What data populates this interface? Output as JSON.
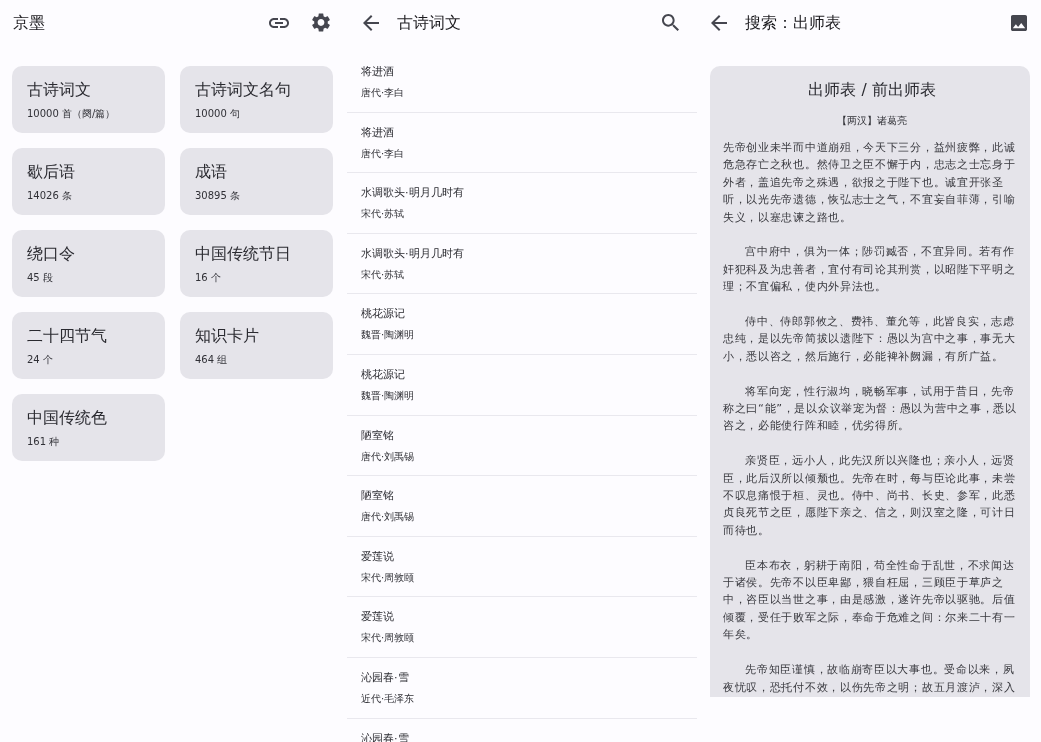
{
  "home": {
    "title": "京墨",
    "cards": [
      {
        "title": "古诗词文",
        "count": "10000 首（阕/篇）"
      },
      {
        "title": "古诗词文名句",
        "count": "10000 句"
      },
      {
        "title": "歇后语",
        "count": "14026 条"
      },
      {
        "title": "成语",
        "count": "30895 条"
      },
      {
        "title": "绕口令",
        "count": "45 段"
      },
      {
        "title": "中国传统节日",
        "count": "16 个"
      },
      {
        "title": "二十四节气",
        "count": "24 个"
      },
      {
        "title": "知识卡片",
        "count": "464 组"
      },
      {
        "title": "中国传统色",
        "count": "161 种"
      }
    ]
  },
  "poem_list": {
    "title": "古诗词文",
    "items": [
      {
        "title": "将进酒",
        "author": "唐代·李白"
      },
      {
        "title": "将进酒",
        "author": "唐代·李白"
      },
      {
        "title": "水调歌头·明月几时有",
        "author": "宋代·苏轼"
      },
      {
        "title": "水调歌头·明月几时有",
        "author": "宋代·苏轼"
      },
      {
        "title": "桃花源记",
        "author": "魏晋·陶渊明"
      },
      {
        "title": "桃花源记",
        "author": "魏晋·陶渊明"
      },
      {
        "title": "陋室铭",
        "author": "唐代·刘禹锡"
      },
      {
        "title": "陋室铭",
        "author": "唐代·刘禹锡"
      },
      {
        "title": "爱莲说",
        "author": "宋代·周敦颐"
      },
      {
        "title": "爱莲说",
        "author": "宋代·周敦颐"
      },
      {
        "title": "沁园春·雪",
        "author": "近代·毛泽东"
      },
      {
        "title": "沁园春·雪"
      }
    ]
  },
  "search_result": {
    "title": "搜索：出师表",
    "poem": {
      "title": "出师表 / 前出师表",
      "author": "【两汉】诸葛亮",
      "paragraphs": [
        {
          "indented": false,
          "text": "先帝创业未半而中道崩殂，今天下三分，益州疲弊，此诚危急存亡之秋也。然侍卫之臣不懈于内，忠志之士忘身于外者，盖追先帝之殊遇，欲报之于陛下也。诚宜开张圣听，以光先帝遗德，恢弘志士之气，不宜妄自菲薄，引喻失义，以塞忠谏之路也。"
        },
        {
          "indented": true,
          "text": "宫中府中，俱为一体；陟罚臧否，不宜异同。若有作奸犯科及为忠善者，宜付有司论其刑赏，以昭陛下平明之理；不宜偏私，使内外异法也。"
        },
        {
          "indented": true,
          "text": "侍中、侍郎郭攸之、费祎、董允等，此皆良实，志虑忠纯，是以先帝简拔以遗陛下：愚以为宫中之事，事无大小，悉以咨之，然后施行，必能裨补阙漏，有所广益。"
        },
        {
          "indented": true,
          "text": "将军向宠，性行淑均，晓畅军事，试用于昔日，先帝称之曰“能”，是以众议举宠为督：愚以为营中之事，悉以咨之，必能使行阵和睦，优劣得所。"
        },
        {
          "indented": true,
          "text": "亲贤臣，远小人，此先汉所以兴隆也；亲小人，远贤臣，此后汉所以倾颓也。先帝在时，每与臣论此事，未尝不叹息痛恨于桓、灵也。侍中、尚书、长史、参军，此悉贞良死节之臣，愿陛下亲之、信之，则汉室之隆，可计日而待也。"
        },
        {
          "indented": true,
          "text": "臣本布衣，躬耕于南阳，苟全性命于乱世，不求闻达于诸侯。先帝不以臣卑鄙，猥自枉屈，三顾臣于草庐之中，咨臣以当世之事，由是感激，遂许先帝以驱驰。后值倾覆，受任于败军之际，奉命于危难之间：尔来二十有一年矣。"
        },
        {
          "indented": true,
          "text": "先帝知臣谨慎，故临崩寄臣以大事也。受命以来，夙夜忧叹，恐托付不效，以伤先帝之明；故五月渡泸，深入"
        }
      ]
    }
  }
}
